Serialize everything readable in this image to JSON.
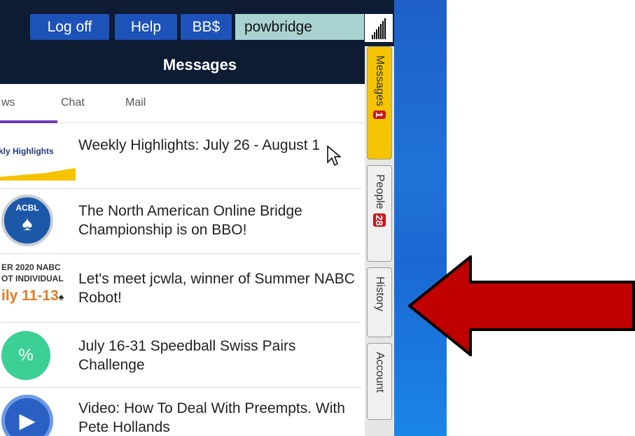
{
  "topbar": {
    "logoff_label": "Log off",
    "help_label": "Help",
    "bb_label": "BB$",
    "username": "powbridge"
  },
  "messages_panel": {
    "title": "Messages",
    "tabs": [
      {
        "label": "ws"
      },
      {
        "label": "Chat"
      },
      {
        "label": "Mail"
      }
    ],
    "items": [
      {
        "thumb_text": "kly Highlights",
        "title": "Weekly Highlights: July 26 - August 1"
      },
      {
        "thumb_text": "ACBL",
        "title": "The North American Online Bridge Championship is on BBO!"
      },
      {
        "thumb_line1": "ER 2020 NABC",
        "thumb_line2": "OT INDIVIDUAL",
        "thumb_line3": "ily 11-13",
        "title": "Let's meet jcwla, winner of Summer NABC Robot!"
      },
      {
        "thumb_icon": "%",
        "title": "July 16-31 Speedball Swiss Pairs Challenge"
      },
      {
        "thumb_icon": "play",
        "title": "Video: How To Deal With Preempts. With Pete Hollands"
      }
    ]
  },
  "sidebar": {
    "tabs": [
      {
        "label": "Messages",
        "badge": "1"
      },
      {
        "label": "People",
        "badge": "28"
      },
      {
        "label": "History"
      },
      {
        "label": "Account"
      }
    ]
  },
  "colors": {
    "topbar_bg": "#0d1c33",
    "button_bg": "#1d52b8",
    "active_tab": "#f5c400",
    "badge": "#c8171e",
    "arrow_fill": "#c00000"
  }
}
